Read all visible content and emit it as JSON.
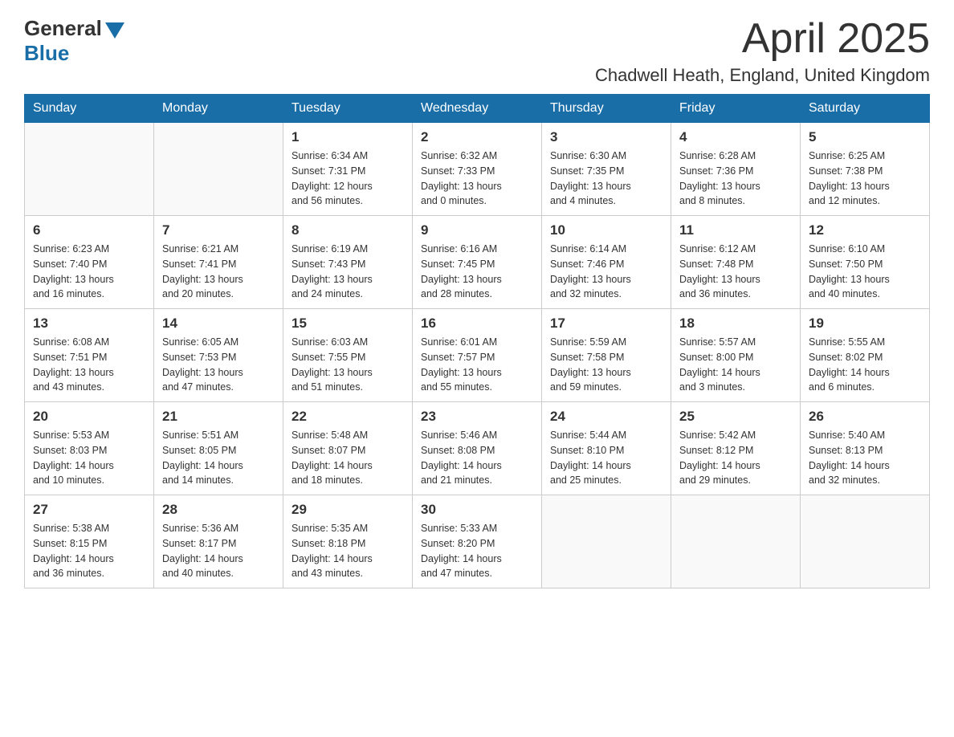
{
  "logo": {
    "general": "General",
    "blue": "Blue"
  },
  "header": {
    "month_year": "April 2025",
    "location": "Chadwell Heath, England, United Kingdom"
  },
  "days_of_week": [
    "Sunday",
    "Monday",
    "Tuesday",
    "Wednesday",
    "Thursday",
    "Friday",
    "Saturday"
  ],
  "weeks": [
    [
      {
        "day": "",
        "info": ""
      },
      {
        "day": "",
        "info": ""
      },
      {
        "day": "1",
        "info": "Sunrise: 6:34 AM\nSunset: 7:31 PM\nDaylight: 12 hours\nand 56 minutes."
      },
      {
        "day": "2",
        "info": "Sunrise: 6:32 AM\nSunset: 7:33 PM\nDaylight: 13 hours\nand 0 minutes."
      },
      {
        "day": "3",
        "info": "Sunrise: 6:30 AM\nSunset: 7:35 PM\nDaylight: 13 hours\nand 4 minutes."
      },
      {
        "day": "4",
        "info": "Sunrise: 6:28 AM\nSunset: 7:36 PM\nDaylight: 13 hours\nand 8 minutes."
      },
      {
        "day": "5",
        "info": "Sunrise: 6:25 AM\nSunset: 7:38 PM\nDaylight: 13 hours\nand 12 minutes."
      }
    ],
    [
      {
        "day": "6",
        "info": "Sunrise: 6:23 AM\nSunset: 7:40 PM\nDaylight: 13 hours\nand 16 minutes."
      },
      {
        "day": "7",
        "info": "Sunrise: 6:21 AM\nSunset: 7:41 PM\nDaylight: 13 hours\nand 20 minutes."
      },
      {
        "day": "8",
        "info": "Sunrise: 6:19 AM\nSunset: 7:43 PM\nDaylight: 13 hours\nand 24 minutes."
      },
      {
        "day": "9",
        "info": "Sunrise: 6:16 AM\nSunset: 7:45 PM\nDaylight: 13 hours\nand 28 minutes."
      },
      {
        "day": "10",
        "info": "Sunrise: 6:14 AM\nSunset: 7:46 PM\nDaylight: 13 hours\nand 32 minutes."
      },
      {
        "day": "11",
        "info": "Sunrise: 6:12 AM\nSunset: 7:48 PM\nDaylight: 13 hours\nand 36 minutes."
      },
      {
        "day": "12",
        "info": "Sunrise: 6:10 AM\nSunset: 7:50 PM\nDaylight: 13 hours\nand 40 minutes."
      }
    ],
    [
      {
        "day": "13",
        "info": "Sunrise: 6:08 AM\nSunset: 7:51 PM\nDaylight: 13 hours\nand 43 minutes."
      },
      {
        "day": "14",
        "info": "Sunrise: 6:05 AM\nSunset: 7:53 PM\nDaylight: 13 hours\nand 47 minutes."
      },
      {
        "day": "15",
        "info": "Sunrise: 6:03 AM\nSunset: 7:55 PM\nDaylight: 13 hours\nand 51 minutes."
      },
      {
        "day": "16",
        "info": "Sunrise: 6:01 AM\nSunset: 7:57 PM\nDaylight: 13 hours\nand 55 minutes."
      },
      {
        "day": "17",
        "info": "Sunrise: 5:59 AM\nSunset: 7:58 PM\nDaylight: 13 hours\nand 59 minutes."
      },
      {
        "day": "18",
        "info": "Sunrise: 5:57 AM\nSunset: 8:00 PM\nDaylight: 14 hours\nand 3 minutes."
      },
      {
        "day": "19",
        "info": "Sunrise: 5:55 AM\nSunset: 8:02 PM\nDaylight: 14 hours\nand 6 minutes."
      }
    ],
    [
      {
        "day": "20",
        "info": "Sunrise: 5:53 AM\nSunset: 8:03 PM\nDaylight: 14 hours\nand 10 minutes."
      },
      {
        "day": "21",
        "info": "Sunrise: 5:51 AM\nSunset: 8:05 PM\nDaylight: 14 hours\nand 14 minutes."
      },
      {
        "day": "22",
        "info": "Sunrise: 5:48 AM\nSunset: 8:07 PM\nDaylight: 14 hours\nand 18 minutes."
      },
      {
        "day": "23",
        "info": "Sunrise: 5:46 AM\nSunset: 8:08 PM\nDaylight: 14 hours\nand 21 minutes."
      },
      {
        "day": "24",
        "info": "Sunrise: 5:44 AM\nSunset: 8:10 PM\nDaylight: 14 hours\nand 25 minutes."
      },
      {
        "day": "25",
        "info": "Sunrise: 5:42 AM\nSunset: 8:12 PM\nDaylight: 14 hours\nand 29 minutes."
      },
      {
        "day": "26",
        "info": "Sunrise: 5:40 AM\nSunset: 8:13 PM\nDaylight: 14 hours\nand 32 minutes."
      }
    ],
    [
      {
        "day": "27",
        "info": "Sunrise: 5:38 AM\nSunset: 8:15 PM\nDaylight: 14 hours\nand 36 minutes."
      },
      {
        "day": "28",
        "info": "Sunrise: 5:36 AM\nSunset: 8:17 PM\nDaylight: 14 hours\nand 40 minutes."
      },
      {
        "day": "29",
        "info": "Sunrise: 5:35 AM\nSunset: 8:18 PM\nDaylight: 14 hours\nand 43 minutes."
      },
      {
        "day": "30",
        "info": "Sunrise: 5:33 AM\nSunset: 8:20 PM\nDaylight: 14 hours\nand 47 minutes."
      },
      {
        "day": "",
        "info": ""
      },
      {
        "day": "",
        "info": ""
      },
      {
        "day": "",
        "info": ""
      }
    ]
  ],
  "colors": {
    "header_bg": "#1a6ea8",
    "header_text": "#ffffff",
    "border": "#cccccc"
  }
}
